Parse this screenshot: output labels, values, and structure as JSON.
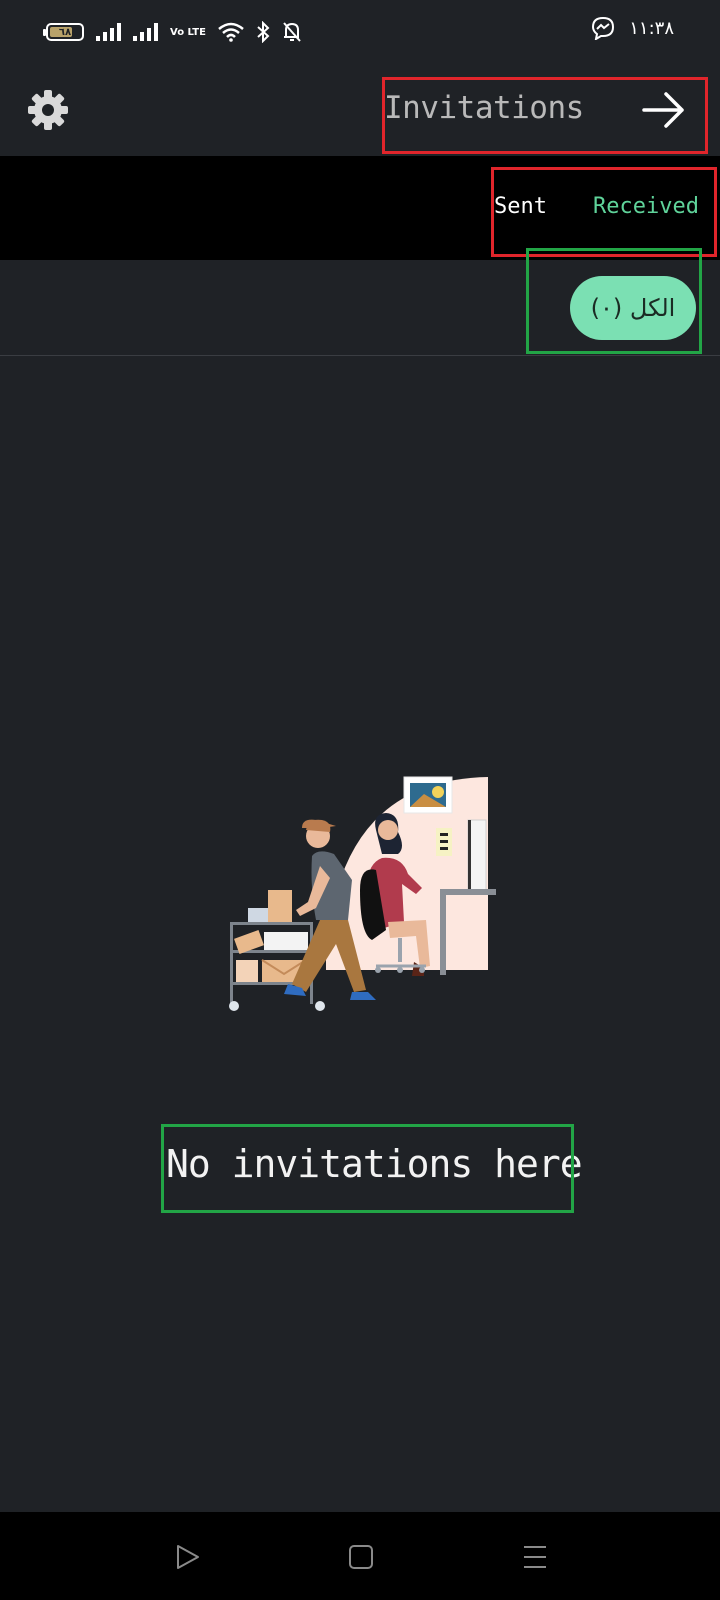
{
  "status_bar": {
    "battery_level": "٦٨",
    "volte_label": "Vo LTE",
    "time": "١١:٣٨"
  },
  "header": {
    "title": "Invitations",
    "settings_icon": "gear-icon",
    "forward_icon": "arrow-right-icon"
  },
  "tabs": [
    {
      "label": "Sent",
      "active": false
    },
    {
      "label": "Received",
      "active": true
    }
  ],
  "filter": {
    "label": "الكل (٠)"
  },
  "empty_state": {
    "message": "No invitations here"
  },
  "nav_bar": {
    "items": [
      "back-triangle-icon",
      "home-square-icon",
      "menu-lines-icon"
    ]
  },
  "colors": {
    "background": "#1f2226",
    "accent": "#5fd39a",
    "chip": "#7be0b3"
  }
}
